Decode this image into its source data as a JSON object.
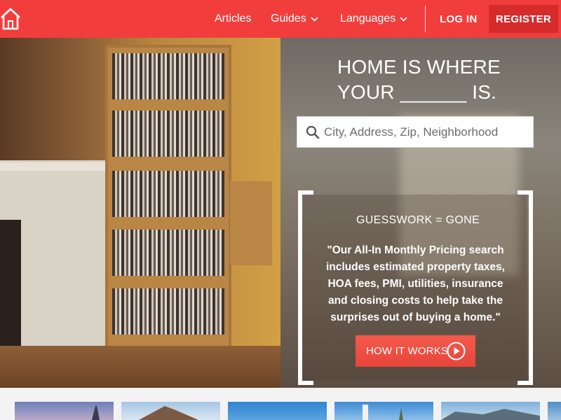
{
  "header": {
    "logo": "house-icon",
    "nav": {
      "articles": "Articles",
      "guides": "Guides",
      "languages": "Languages"
    },
    "login": "LOG IN",
    "register": "REGISTER"
  },
  "hero": {
    "headline_line1": "HOME IS WHERE",
    "headline_line2": "YOUR ______ IS.",
    "search": {
      "placeholder": "City, Address, Zip, Neighborhood",
      "value": ""
    },
    "promo": {
      "title": "GUESSWORK = GONE",
      "quote": "\"Our All-In Monthly Pricing search includes estimated property taxes, HOA fees, PMI, utilities, insurance and closing costs to help take the surprises out of buying a home.\"",
      "button": "HOW IT WORKS"
    }
  },
  "colors": {
    "brand_red": "#f23d3d",
    "register_red": "#d62b2b",
    "button_red": "#e6453c"
  }
}
